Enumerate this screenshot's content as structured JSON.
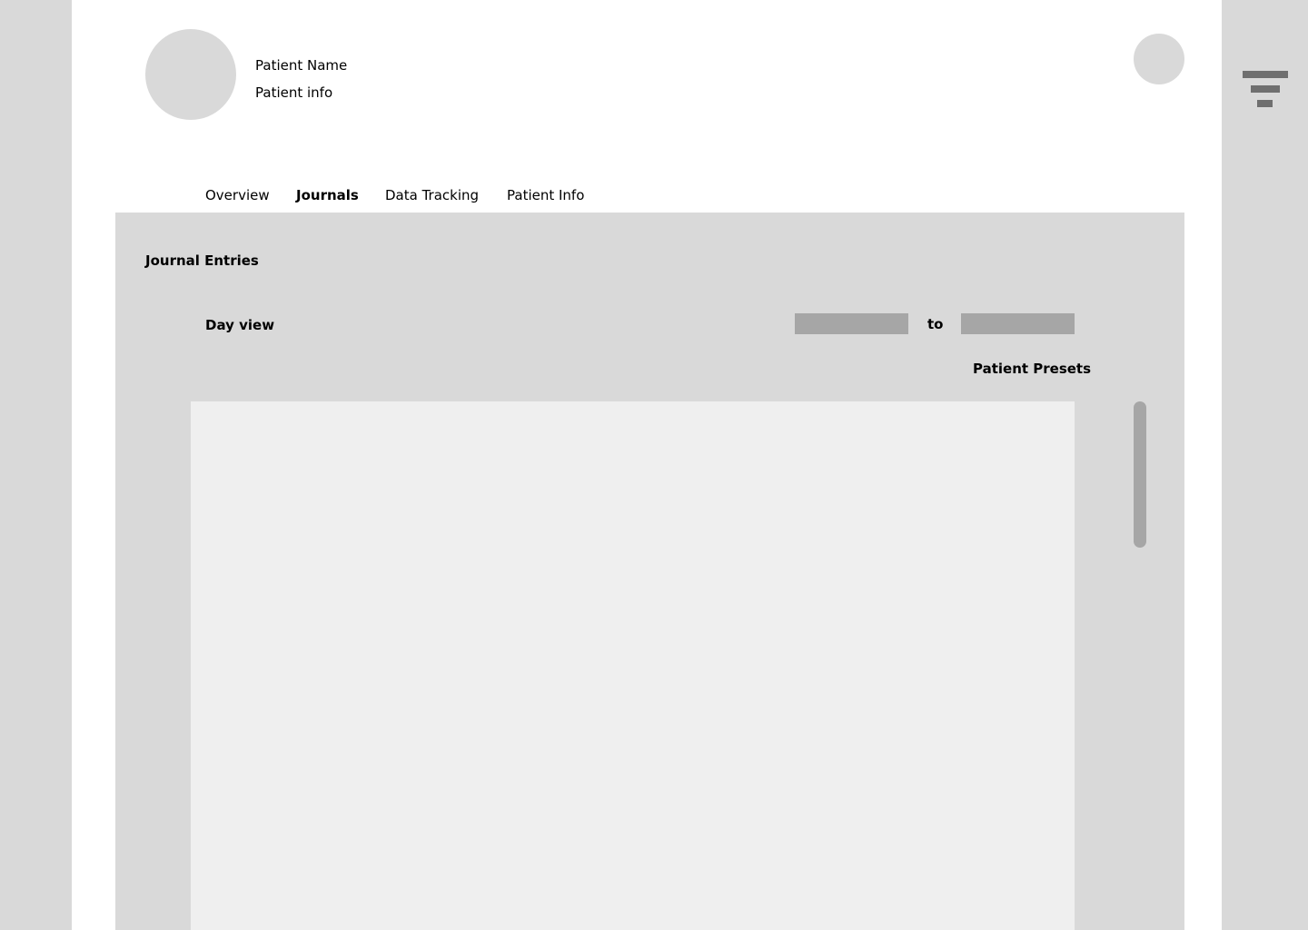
{
  "header": {
    "patient_name": "Patient Name",
    "patient_info": "Patient info"
  },
  "tabs": [
    {
      "label": "Overview",
      "active": false
    },
    {
      "label": "Journals",
      "active": true
    },
    {
      "label": "Data Tracking",
      "active": false
    },
    {
      "label": "Patient Info",
      "active": false
    }
  ],
  "journal": {
    "title": "Journal Entries",
    "view_label": "Day view",
    "date_from": "",
    "date_separator": "to",
    "date_to": "",
    "presets_label": "Patient Presets"
  },
  "icons": {
    "filter": "filter-icon",
    "avatar": "avatar-icon"
  },
  "colors": {
    "background": "#d9d9d9",
    "page": "#ffffff",
    "panel": "#d9d9d9",
    "entries_area": "#efefef",
    "input": "#a6a6a6",
    "icon": "#6f6f6f"
  }
}
